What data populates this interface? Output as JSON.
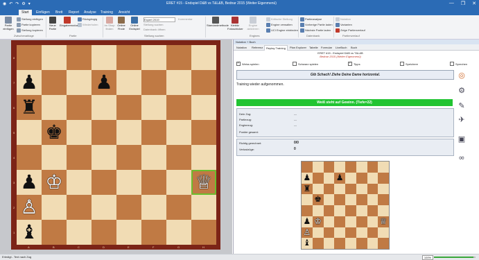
{
  "window": {
    "title": "ERET #15 - Endspiel D&B vs T&L&B, Bednar 2015 (Weiter Eigenmenü)",
    "quick_access": [
      "◉",
      "↶",
      "↷",
      "⚙",
      "▾"
    ],
    "controls": [
      "—",
      "❐",
      "✕"
    ]
  },
  "ribbon_tabs": [
    "Datei",
    "Start",
    "Einfügen",
    "Brett",
    "Report",
    "Analyse",
    "Training",
    "Ansicht"
  ],
  "ribbon": {
    "items": [
      "Partie einfügen",
      "Stellung einfügen",
      "Partie kopieren",
      "Stellung kopieren",
      "Neue Partie",
      "Eingabemodus",
      "Rückgängig",
      "Wiederholen",
      "Im Shop finden",
      "Online Finde",
      "Online Endspiel",
      "Stellung suchen",
      "Datenbank öffnen",
      "Kommentar",
      "Kritische Stellung",
      "Referenz",
      "Ähnliche Stellungen",
      "Standardmethode",
      "Kiebitz Fotoschicker",
      "Engine aktivieren",
      "Engine verwalten",
      "UCI Engine einbinden",
      "Partieanalyse",
      "Vorherige Partie laden",
      "Nächste Partie laden",
      "Notation",
      "Varianten",
      "Zeige Partienverlauf"
    ],
    "dropdown_value": "Expert 2019",
    "groups": [
      "Zwischenablage",
      "Partie",
      "Stellung suchen",
      "Engines",
      "Datenbank",
      "Partienverlauf"
    ]
  },
  "board": {
    "files": [
      "A",
      "B",
      "C",
      "D",
      "E",
      "F",
      "G",
      "H"
    ],
    "ranks": [
      "8",
      "7",
      "6",
      "5",
      "4",
      "3",
      "2",
      "1"
    ],
    "pieces": [
      {
        "square": "a7",
        "glyph": "♟",
        "color": "b"
      },
      {
        "square": "d7",
        "glyph": "♟",
        "color": "b"
      },
      {
        "square": "a6",
        "glyph": "♜",
        "color": "b"
      },
      {
        "square": "b5",
        "glyph": "♚",
        "color": "b"
      },
      {
        "square": "a3",
        "glyph": "♟",
        "color": "b"
      },
      {
        "square": "b3",
        "glyph": "♔",
        "color": "w"
      },
      {
        "square": "h3",
        "glyph": "♕",
        "color": "w",
        "highlight": true
      },
      {
        "square": "a2",
        "glyph": "♙",
        "color": "w"
      },
      {
        "square": "a1",
        "glyph": "♝",
        "color": "b"
      }
    ]
  },
  "panel": {
    "header": "Notation + Buch",
    "tabs": [
      "Notation",
      "Referenz",
      "Replay Training",
      "Plan Explorer",
      "Tabelle",
      "Formular",
      "LiveBuch",
      "Buch"
    ],
    "active_tab": "Replay Training",
    "game_line1": "ERET #15 - Endspiel D&B vs T&L&B",
    "game_line2": "Bednar 2015 (Weiter Eigenmenü)",
    "options": [
      {
        "label": "Weiss spielen",
        "checked": true
      },
      {
        "label": "Schwarz spielen",
        "checked": false
      },
      {
        "label": "Tipps",
        "checked": true
      },
      {
        "label": "Speichere",
        "checked": false
      },
      {
        "label": "Sprechen",
        "checked": false
      }
    ],
    "prompt": "Gib Schach! Ziehe Deine Dame horizontal.",
    "info": "Training wieder aufgenommen.",
    "eval": "Weiß steht auf Gewinn. (Tiefe=22)",
    "stats": [
      {
        "label": "Dein Zug:",
        "value": "---"
      },
      {
        "label": "Partiezug:",
        "value": "---"
      },
      {
        "label": "Enginezug:",
        "value": "---"
      },
      {
        "label": "Punkte gesamt:",
        "value": ""
      }
    ],
    "score": [
      {
        "label": "Richtig gerechnet:",
        "value": "0/0"
      },
      {
        "label": "Verlustzüge:",
        "value": "0"
      }
    ],
    "side_icons": [
      "lifebuoy-icon",
      "gears-icon",
      "wrench-icon",
      "satellite-icon",
      "save-icon",
      "glasses-icon"
    ]
  },
  "status": {
    "text": "Erledigt - Text nach Zug",
    "zoom": "100%",
    "zoom_fraction": 0.95
  }
}
